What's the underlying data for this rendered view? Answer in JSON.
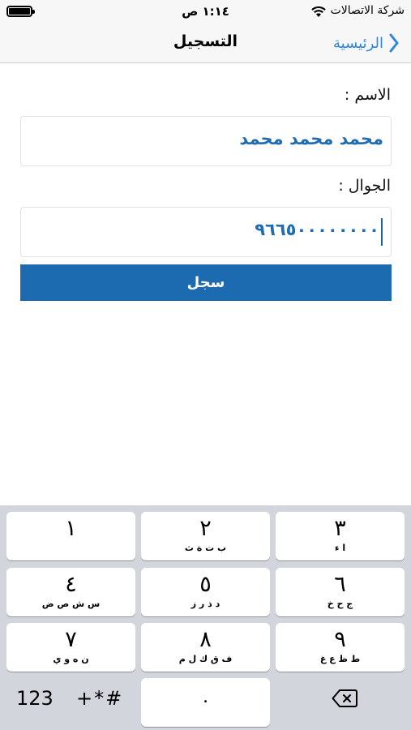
{
  "status_bar": {
    "carrier": "شركة الاتصالات",
    "time": "١:١٤ ص"
  },
  "nav": {
    "title": "التسجيل",
    "back_label": "الرئيسية"
  },
  "form": {
    "name_label": "الاسم :",
    "name_value": "محمد محمد محمد",
    "phone_label": "الجوال :",
    "phone_value": "٩٦٦٥٠٠٠٠٠٠٠٠",
    "submit_label": "سجل"
  },
  "keypad": {
    "keys": [
      {
        "digit": "١",
        "letters": ""
      },
      {
        "digit": "٢",
        "letters": "ب ت ة ث"
      },
      {
        "digit": "٣",
        "letters": "ا ء"
      },
      {
        "digit": "٤",
        "letters": "س ش ص ض"
      },
      {
        "digit": "٥",
        "letters": "د ذ ر ز"
      },
      {
        "digit": "٦",
        "letters": "ج ح خ"
      },
      {
        "digit": "٧",
        "letters": "ن ه و ي"
      },
      {
        "digit": "٨",
        "letters": "ف ق ك ل م"
      },
      {
        "digit": "٩",
        "letters": "ط ظ ع غ"
      }
    ],
    "numbers_key": "123",
    "symbols_key": "+*#",
    "zero_key": "٠"
  },
  "colors": {
    "accent": "#1c6bb1",
    "link": "#2f86de",
    "keyboard_bg": "#d2d5db"
  },
  "icons": {
    "back": "chevron-left-icon",
    "wifi": "wifi-icon",
    "battery": "battery-icon",
    "delete": "delete-backspace-icon"
  }
}
